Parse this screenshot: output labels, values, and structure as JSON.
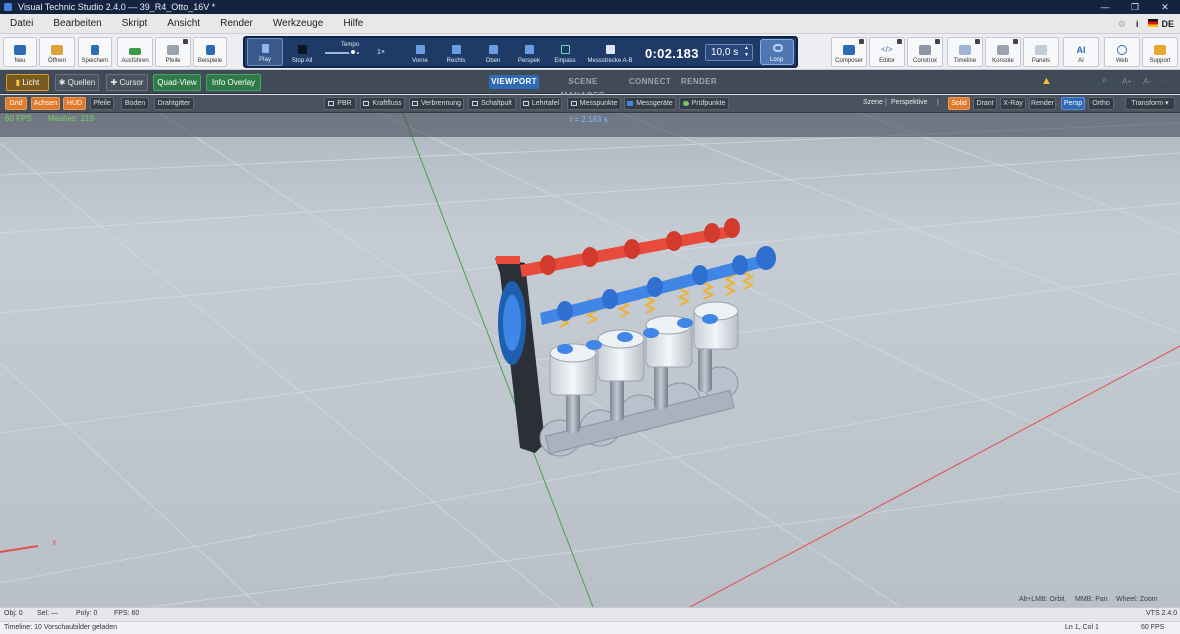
{
  "window": {
    "title": "Visual Technic Studio 2.4.0 — 39_R4_Otto_16V *"
  },
  "menu": [
    "Datei",
    "Bearbeiten",
    "Skript",
    "Ansicht",
    "Render",
    "Werkzeuge",
    "Hilfe"
  ],
  "menu_right": {
    "info": "i",
    "lang": "DE"
  },
  "toolbar": {
    "left": [
      "Neu",
      "Öffnen",
      "Speichern",
      "Ausführen",
      "Pfeile",
      "Beispiele"
    ],
    "transport": {
      "play": "Play",
      "stop": "Stop All",
      "tempo": "Tempo",
      "speed": "1×",
      "views": [
        "Vorne",
        "Rechts",
        "Oben",
        "Perspek",
        "Einpass",
        "Messstrecke A-B"
      ],
      "time": "0:02.183",
      "duration": "10,0 s",
      "loop": "Loop"
    },
    "right": [
      "Composer",
      "Editor",
      "Construx",
      "Timeline",
      "Konsole",
      "Panels",
      "AI",
      "Web",
      "Support"
    ],
    "ai_glyph": "AI"
  },
  "bar2": {
    "buttons": [
      "Licht",
      "Quellen",
      "Cursor",
      "Quad-View",
      "Info Overlay"
    ],
    "tabs": [
      "VIEWPORT",
      "SCENE MANAGER",
      "CONNECT",
      "RENDER"
    ]
  },
  "bar3": {
    "toggles": [
      "Grid",
      "Achsen",
      "HUD",
      "Pfeile",
      "Boden",
      "Drahtgitter"
    ],
    "tools": [
      "PBR",
      "Kraftfluss",
      "Verbrennung",
      "Schaltpult",
      "Lehrtafel",
      "Messpunkte",
      "Messgeräte",
      "Prüfpunkte"
    ],
    "scene": "Szene",
    "sep": "|",
    "view": "Perspektive",
    "modes": [
      "Solid",
      "Drant",
      "X-Ray",
      "Render"
    ],
    "proj": [
      "Persp",
      "Ortho"
    ],
    "transform": "Transform"
  },
  "viewport": {
    "fps": "60 FPS",
    "meshes": "Meshes: 219",
    "t": "t = 2.183 s",
    "axis_x": "X",
    "hints": [
      "Alt+LMB: Orbit",
      "MMB: Pan",
      "Wheel: Zoom"
    ]
  },
  "status1": {
    "obj": "Obj: 0",
    "sel": "Sel: —",
    "poly": "Poly: 0",
    "fps": "FPS: 60",
    "version": "VTS 2.4.0"
  },
  "status2": {
    "message": "Timeline: 10 Vorschaubilder geladen",
    "pos": "Ln 1, Col 1",
    "fps": "60 FPS"
  },
  "colors": {
    "accent": "#2f6ab5",
    "orange": "#e07a2e",
    "green": "#2f7a48",
    "cam": "#e84a3c",
    "valve_blue": "#3f86e6"
  }
}
